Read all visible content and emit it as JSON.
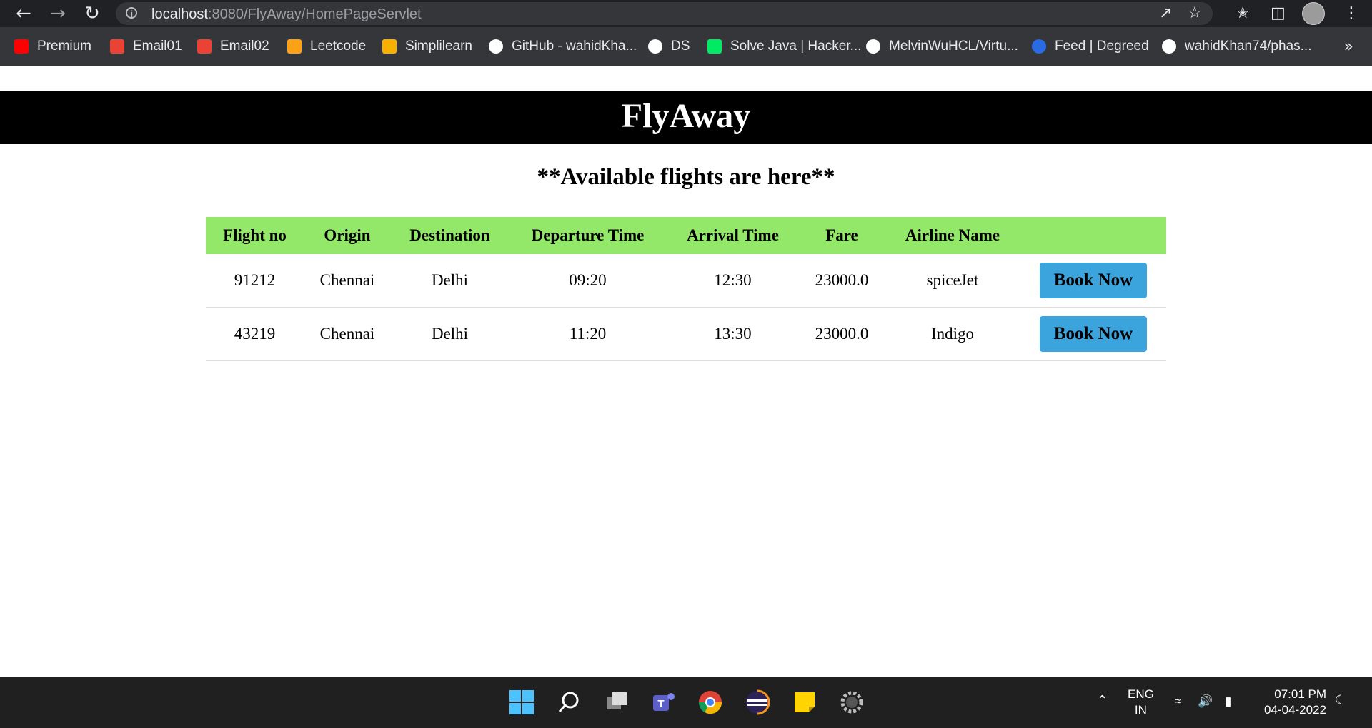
{
  "browser": {
    "back_icon": "arrow-left-icon",
    "forward_icon": "arrow-right-icon",
    "reload_icon": "reload-icon",
    "url_host": "localhost",
    "url_rest": ":8080/FlyAway/HomePageServlet",
    "bookmarks": [
      {
        "label": "Premium",
        "icon": "youtube-icon",
        "color": "#ff0000"
      },
      {
        "label": "Email01",
        "icon": "gmail-icon",
        "color": "#ea4335"
      },
      {
        "label": "Email02",
        "icon": "gmail-icon",
        "color": "#ea4335"
      },
      {
        "label": "Leetcode",
        "icon": "leetcode-icon",
        "color": "#ffa116"
      },
      {
        "label": "Simplilearn",
        "icon": "simplilearn-icon",
        "color": "#f9b000"
      },
      {
        "label": "GitHub - wahidKha...",
        "icon": "github-icon",
        "color": "#ffffff"
      },
      {
        "label": "DS",
        "icon": "github-icon",
        "color": "#ffffff"
      },
      {
        "label": "Solve Java | Hacker...",
        "icon": "hackerrank-icon",
        "color": "#00ea64"
      },
      {
        "label": "MelvinWuHCL/Virtu...",
        "icon": "github-icon",
        "color": "#ffffff"
      },
      {
        "label": "Feed | Degreed",
        "icon": "degreed-icon",
        "color": "#2a6be4"
      },
      {
        "label": "wahidKhan74/phas...",
        "icon": "github-icon",
        "color": "#ffffff"
      }
    ],
    "more_label": "»"
  },
  "site": {
    "title": "FlyAway",
    "subtitle": "**Available flights are here**"
  },
  "table": {
    "headers": [
      "Flight no",
      "Origin",
      "Destination",
      "Departure Time",
      "Arrival Time",
      "Fare",
      "Airline Name",
      ""
    ],
    "rows": [
      {
        "flight_no": "91212",
        "origin": "Chennai",
        "destination": "Delhi",
        "departure": "09:20",
        "arrival": "12:30",
        "fare": "23000.0",
        "airline": "spiceJet",
        "action": "Book Now"
      },
      {
        "flight_no": "43219",
        "origin": "Chennai",
        "destination": "Delhi",
        "departure": "11:20",
        "arrival": "13:30",
        "fare": "23000.0",
        "airline": "Indigo",
        "action": "Book Now"
      }
    ]
  },
  "taskbar": {
    "apps": [
      "windows-start-icon",
      "search-icon",
      "task-view-icon",
      "teams-icon",
      "chrome-icon",
      "eclipse-icon",
      "sticky-notes-icon",
      "settings-icon"
    ],
    "language": "ENG",
    "region": "IN",
    "time": "07:01 PM",
    "date": "04-04-2022"
  },
  "colors": {
    "header_bg": "#000000",
    "table_header_bg": "#93e86a",
    "button_bg": "#3ba4dd"
  }
}
